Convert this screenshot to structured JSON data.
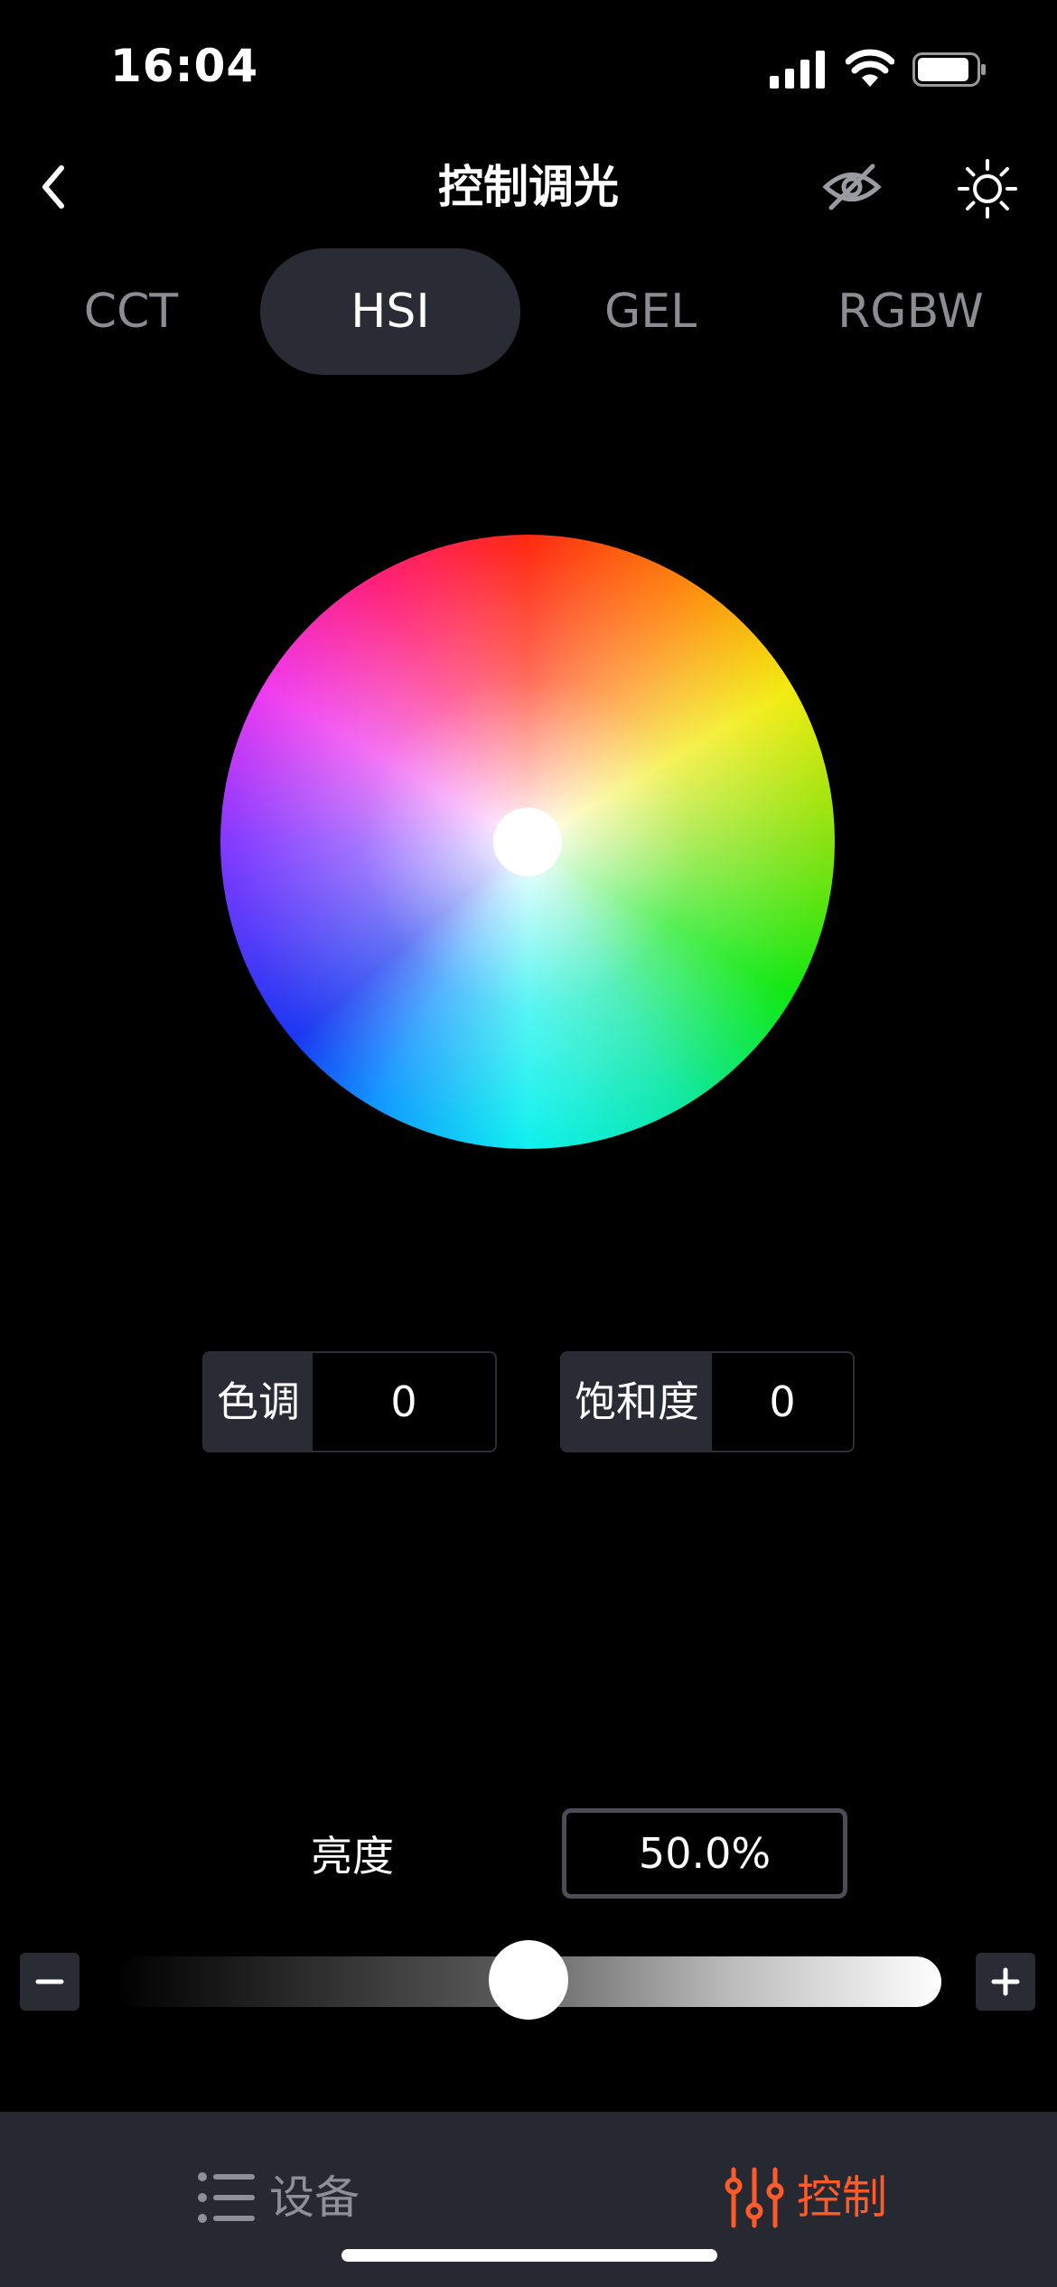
{
  "status_bar": {
    "time": "16:04"
  },
  "header": {
    "title": "控制调光"
  },
  "tabs": [
    {
      "label": "CCT",
      "active": false
    },
    {
      "label": "HSI",
      "active": true
    },
    {
      "label": "GEL",
      "active": false
    },
    {
      "label": "RGBW",
      "active": false
    }
  ],
  "hsi": {
    "hue": {
      "label": "色调",
      "value": "0"
    },
    "saturation": {
      "label": "饱和度",
      "value": "0"
    }
  },
  "brightness": {
    "label": "亮度",
    "value": "50.0%",
    "level": 0.5
  },
  "bottom_nav": [
    {
      "label": "设备",
      "active": false,
      "icon": "list-icon"
    },
    {
      "label": "控制",
      "active": true,
      "icon": "sliders-icon"
    }
  ],
  "colors": {
    "background": "#000000",
    "panel": "#292c35",
    "accent": "#ff5a2a",
    "inactive_text": "#8b8d93"
  }
}
